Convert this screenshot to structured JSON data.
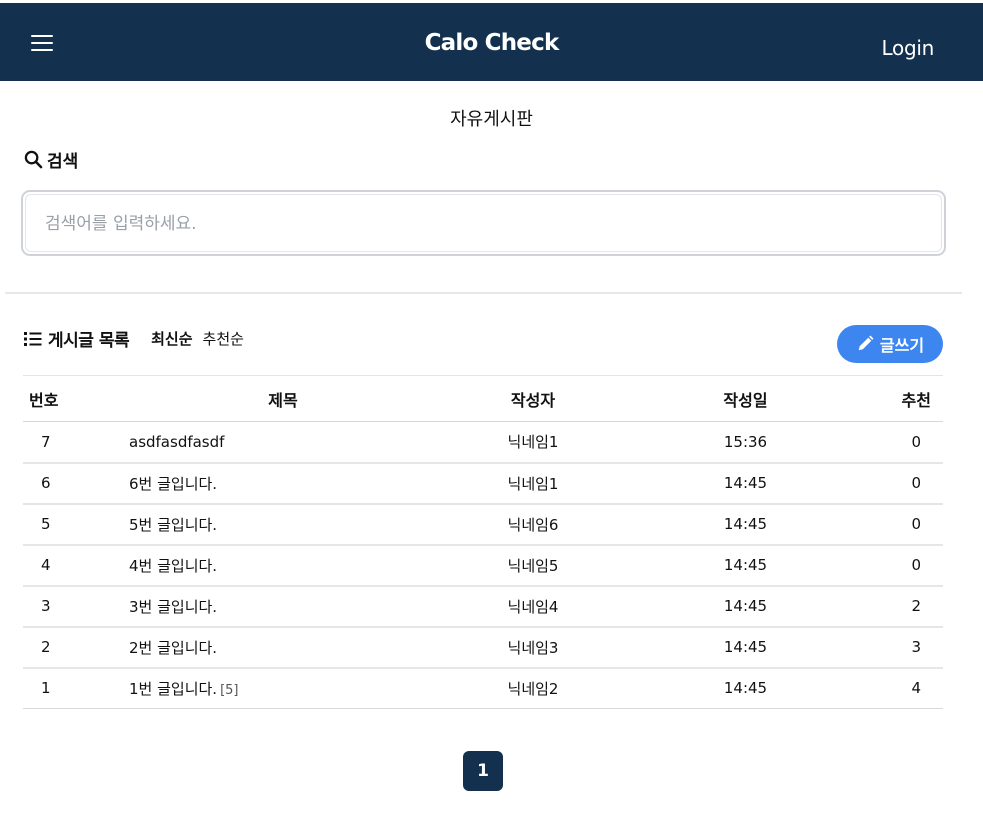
{
  "navbar": {
    "brand": "Calo Check",
    "login_label": "Login"
  },
  "board": {
    "title": "자유게시판"
  },
  "search": {
    "label": "검색",
    "placeholder": "검색어를 입력하세요."
  },
  "list": {
    "title": "게시글 목록",
    "sort_latest": "최신순",
    "sort_recommend": "추천순",
    "write_label": "글쓰기"
  },
  "table": {
    "headers": {
      "no": "번호",
      "title": "제목",
      "author": "작성자",
      "date": "작성일",
      "recommend": "추천"
    },
    "rows": [
      {
        "no": "7",
        "title": "asdfasdfasdf",
        "comments": "",
        "author": "닉네임1",
        "date": "15:36",
        "recommend": "0"
      },
      {
        "no": "6",
        "title": "6번 글입니다.",
        "comments": "",
        "author": "닉네임1",
        "date": "14:45",
        "recommend": "0"
      },
      {
        "no": "5",
        "title": "5번 글입니다.",
        "comments": "",
        "author": "닉네임6",
        "date": "14:45",
        "recommend": "0"
      },
      {
        "no": "4",
        "title": "4번 글입니다.",
        "comments": "",
        "author": "닉네임5",
        "date": "14:45",
        "recommend": "0"
      },
      {
        "no": "3",
        "title": "3번 글입니다.",
        "comments": "",
        "author": "닉네임4",
        "date": "14:45",
        "recommend": "2"
      },
      {
        "no": "2",
        "title": "2번 글입니다.",
        "comments": "",
        "author": "닉네임3",
        "date": "14:45",
        "recommend": "3"
      },
      {
        "no": "1",
        "title": "1번 글입니다.",
        "comments": "[5]",
        "author": "닉네임2",
        "date": "14:45",
        "recommend": "4"
      }
    ]
  },
  "pagination": {
    "current": "1"
  },
  "icons": {
    "menu": "menu-icon",
    "search": "search-icon",
    "list": "list-icon",
    "write": "pencil-icon"
  },
  "colors": {
    "navbar": "#13304f",
    "accent": "#3d86f0",
    "page_active": "#13304f"
  }
}
